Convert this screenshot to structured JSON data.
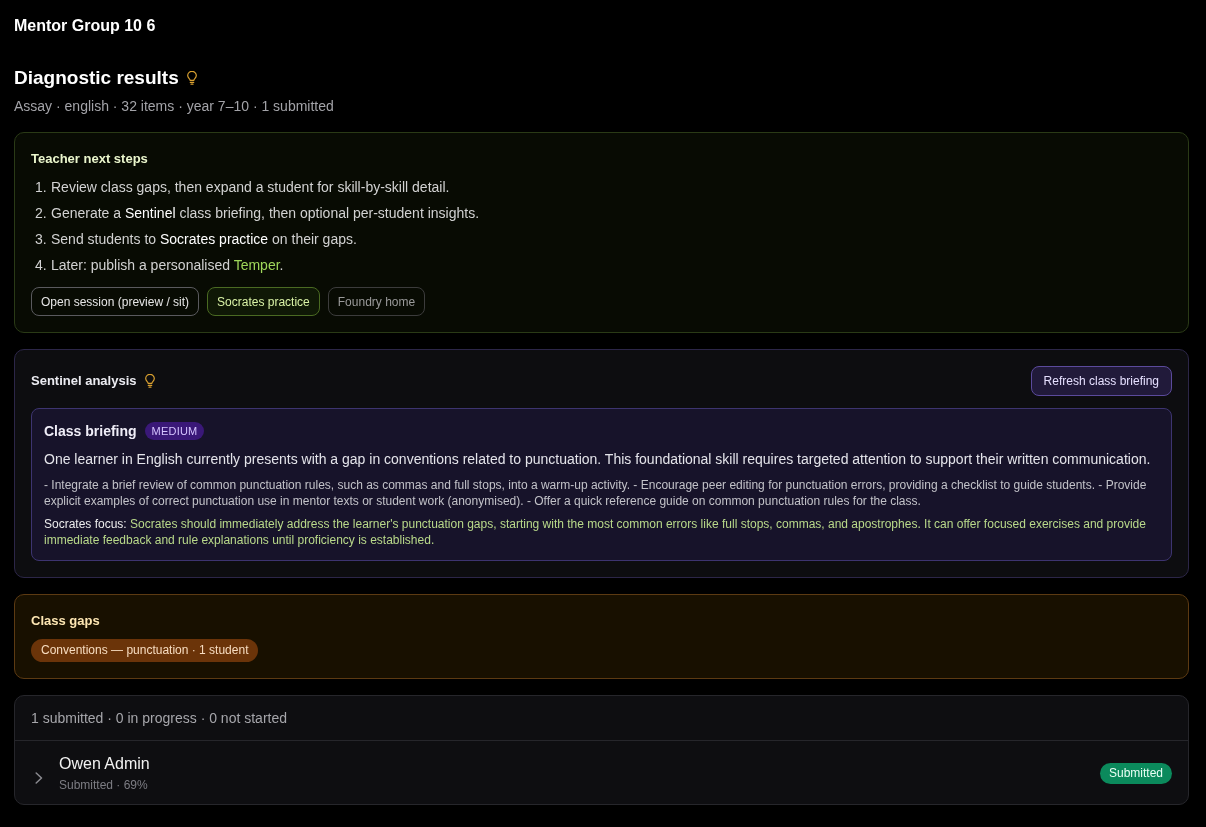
{
  "page_title": "Mentor Group 10 6",
  "header": {
    "title": "Diagnostic results",
    "meta": "Assay · english · 32 items · year 7–10 · 1 submitted"
  },
  "next_steps": {
    "title": "Teacher next steps",
    "steps": [
      {
        "number": "1.",
        "text": "Review class gaps, then expand a student for skill-by-skill detail."
      },
      {
        "number": "2.",
        "text": "Generate a **Sentinel** class briefing, then optional per-student insights."
      },
      {
        "number": "3.",
        "text": "Send students to **Socrates practice** on their gaps."
      },
      {
        "number": "4.",
        "text": "Later: publish a personalised *Temper*."
      }
    ],
    "buttons": [
      {
        "label": "Open session (preview / sit)",
        "kind": "default"
      },
      {
        "label": "Socrates practice",
        "kind": "accent"
      },
      {
        "label": "Foundry home",
        "kind": "muted"
      }
    ]
  },
  "sentinel": {
    "title": "Sentinel analysis",
    "refresh_button": "Refresh class briefing",
    "briefing": {
      "title": "Class briefing",
      "priority": "MEDIUM",
      "summary": "One learner in English currently presents with a gap in conventions related to punctuation. This foundational skill requires targeted attention to support their written communication.",
      "actions": "- Integrate a brief review of common punctuation rules, such as commas and full stops, into a warm-up activity. - Encourage peer editing for punctuation errors, providing a checklist to guide students. - Provide explicit examples of correct punctuation use in mentor texts or student work (anonymised). - Offer a quick reference guide on common punctuation rules for the class.",
      "focus_label": "Socrates focus:",
      "focus": "Socrates should immediately address the learner's punctuation gaps, starting with the most common errors like full stops, commas, and apostrophes. It can offer focused exercises and provide immediate feedback and rule explanations until proficiency is established."
    }
  },
  "class_gaps": {
    "title": "Class gaps",
    "gaps": [
      "Conventions — punctuation · 1 student"
    ]
  },
  "students": {
    "summary": "1 submitted · 0 in progress · 0 not started",
    "rows": [
      {
        "name": "Owen Admin",
        "detail": "Submitted · 69%",
        "status": "Submitted",
        "expanded": false
      }
    ]
  }
}
